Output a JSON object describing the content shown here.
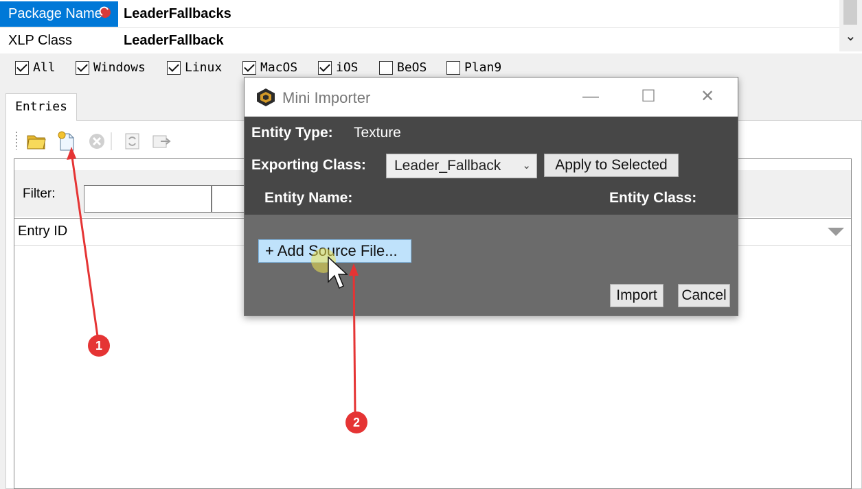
{
  "properties": [
    {
      "key": "Package Name",
      "value": "LeaderFallbacks",
      "selected": true
    },
    {
      "key": "XLP Class",
      "value": "LeaderFallback",
      "selected": false
    }
  ],
  "platforms": [
    {
      "label": "All",
      "checked": true
    },
    {
      "label": "Windows",
      "checked": true
    },
    {
      "label": "Linux",
      "checked": true
    },
    {
      "label": "MacOS",
      "checked": true
    },
    {
      "label": "iOS",
      "checked": true
    },
    {
      "label": "BeOS",
      "checked": false
    },
    {
      "label": "Plan9",
      "checked": false
    }
  ],
  "entries": {
    "tab_label": "Entries",
    "filter_label": "Filter:",
    "column_header": "Entry ID",
    "toolbar_icons": [
      "open-folder-icon",
      "new-file-icon",
      "delete-icon",
      "refresh-icon",
      "export-icon"
    ]
  },
  "dialog": {
    "title": "Mini Importer",
    "entity_type_label": "Entity Type:",
    "entity_type_value": "Texture",
    "exporting_class_label": "Exporting Class:",
    "exporting_class_value": "Leader_Fallback",
    "apply_button": "Apply to Selected",
    "entity_name_header": "Entity Name:",
    "entity_class_header": "Entity Class:",
    "add_source_button": "+ Add Source File...",
    "import_button": "Import",
    "cancel_button": "Cancel",
    "window_controls": [
      "minimize-icon",
      "maximize-icon",
      "close-icon"
    ]
  },
  "annotations": [
    {
      "number": "1"
    },
    {
      "number": "2"
    }
  ],
  "colors": {
    "selection": "#0078d7",
    "dialog_dark": "#474747",
    "dialog_body": "#6b6b6b",
    "add_button": "#bfe2fb",
    "annotation": "#e53434"
  }
}
